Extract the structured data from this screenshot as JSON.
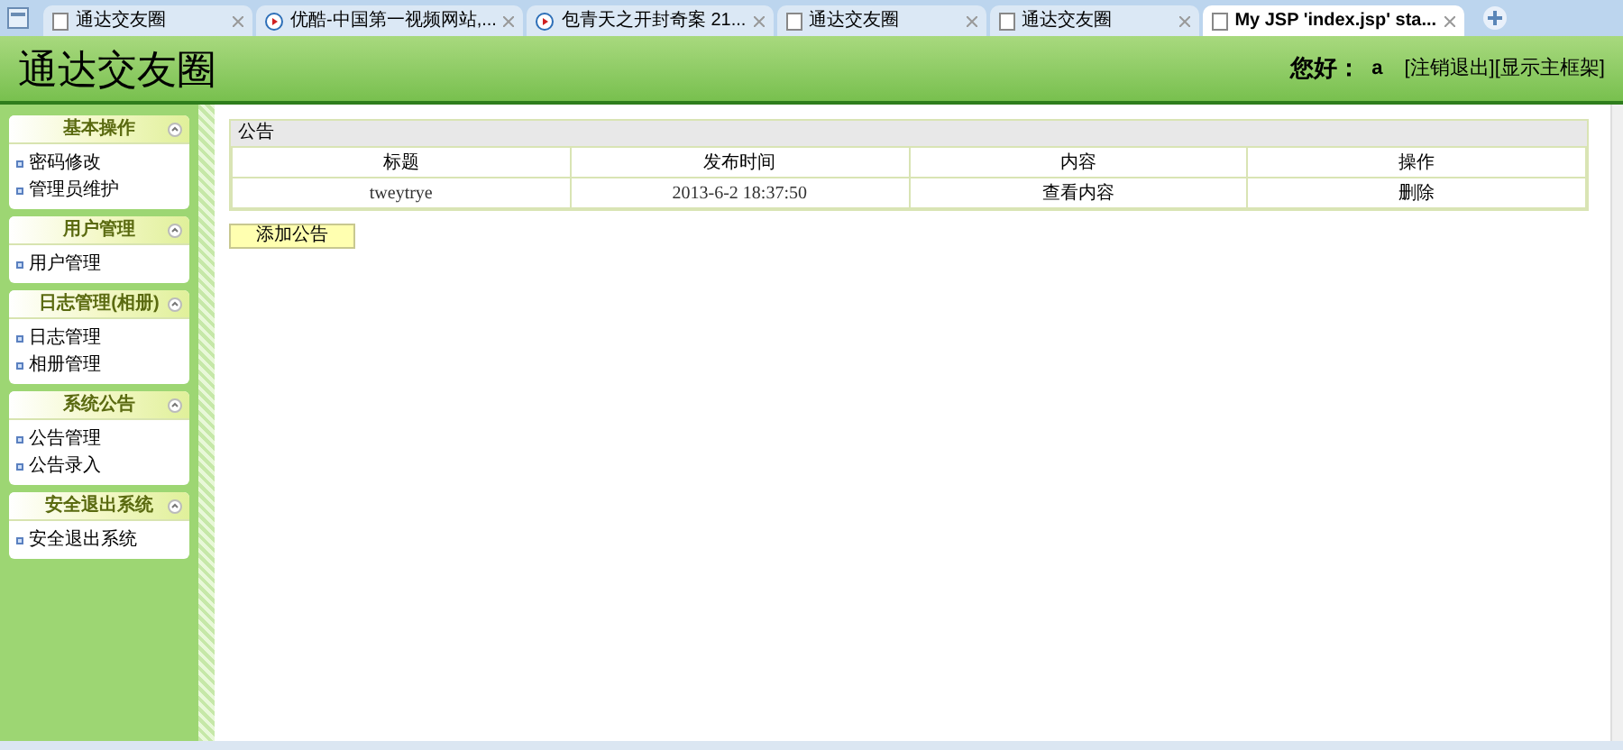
{
  "browser_tabs": [
    {
      "title": "通达交友圈",
      "kind": "page",
      "selected": false
    },
    {
      "title": "优酷-中国第一视频网站,...",
      "kind": "video",
      "selected": false
    },
    {
      "title": "包青天之开封奇案 21...",
      "kind": "video",
      "selected": false
    },
    {
      "title": "通达交友圈",
      "kind": "page",
      "selected": false
    },
    {
      "title": "通达交友圈",
      "kind": "page",
      "selected": false
    },
    {
      "title": "My JSP 'index.jsp' sta...",
      "kind": "page",
      "selected": true
    }
  ],
  "header": {
    "title": "通达交友圈",
    "greeting": "您好：",
    "user": "a",
    "links": [
      "[注销退出]",
      "[显示主框架]"
    ]
  },
  "sidebar": {
    "sections": [
      {
        "title": "基本操作",
        "items": [
          "密码修改",
          "管理员维护"
        ]
      },
      {
        "title": "用户管理",
        "items": [
          "用户管理"
        ]
      },
      {
        "title": "日志管理(相册)",
        "items": [
          "日志管理",
          "相册管理"
        ]
      },
      {
        "title": "系统公告",
        "items": [
          "公告管理",
          "公告录入"
        ]
      },
      {
        "title": "安全退出系统",
        "items": [
          "安全退出系统"
        ]
      }
    ]
  },
  "panel": {
    "title": "公告",
    "table": {
      "columns": [
        "标题",
        "发布时间",
        "内容",
        "操作"
      ],
      "rows": [
        [
          "tweytrye",
          "2013-6-2 18:37:50",
          "查看内容",
          "删除"
        ]
      ]
    },
    "button": "添加公告"
  }
}
